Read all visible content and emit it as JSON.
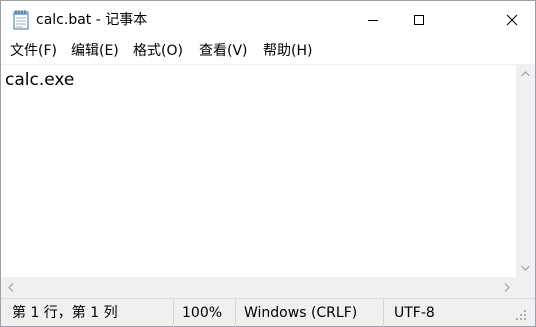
{
  "window": {
    "title": "calc.bat - 记事本",
    "icons": {
      "app": "notepad-icon",
      "minimize": "minimize-icon",
      "maximize": "maximize-icon",
      "close": "close-icon"
    }
  },
  "menu": {
    "items": [
      "文件(F)",
      "编辑(E)",
      "格式(O)",
      "查看(V)",
      "帮助(H)"
    ]
  },
  "editor": {
    "content": "calc.exe"
  },
  "scrollbars": {
    "icons": {
      "up": "chevron-up-icon",
      "down": "chevron-down-icon",
      "left": "chevron-left-icon",
      "right": "chevron-right-icon"
    }
  },
  "status": {
    "position": "第 1 行，第 1 列",
    "zoom": "100%",
    "line_ending": "Windows (CRLF)",
    "encoding": "UTF-8"
  }
}
